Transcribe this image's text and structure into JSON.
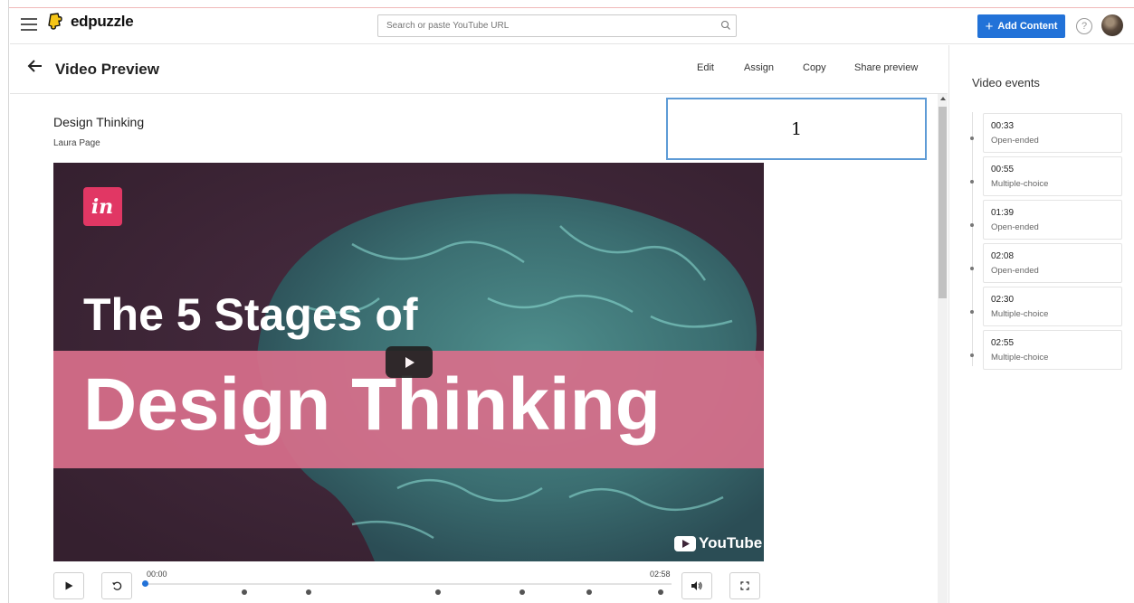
{
  "app": {
    "name": "edpuzzle",
    "search_placeholder": "Search or paste YouTube URL",
    "add_content_label": "Add Content",
    "help_glyph": "?"
  },
  "header": {
    "title": "Video Preview",
    "actions": [
      "Edit",
      "Assign",
      "Copy",
      "Share preview"
    ]
  },
  "video": {
    "title": "Design Thinking",
    "author": "Laura Page",
    "thumbnail_text": {
      "brand": "in",
      "line1": "The 5 Stages of",
      "line2": "Design Thinking",
      "platform": "YouTube"
    },
    "current_time": "00:00",
    "duration": "02:58"
  },
  "annotation": {
    "label": "1"
  },
  "events": {
    "title": "Video events",
    "items": [
      {
        "time": "00:33",
        "type": "Open-ended"
      },
      {
        "time": "00:55",
        "type": "Multiple-choice"
      },
      {
        "time": "01:39",
        "type": "Open-ended"
      },
      {
        "time": "02:08",
        "type": "Open-ended"
      },
      {
        "time": "02:30",
        "type": "Multiple-choice"
      },
      {
        "time": "02:55",
        "type": "Multiple-choice"
      }
    ]
  },
  "colors": {
    "accent": "#2272d8",
    "banner_pink": "#d76f8b",
    "invision_pink": "#e13764",
    "video_bg": "#3e2538"
  }
}
